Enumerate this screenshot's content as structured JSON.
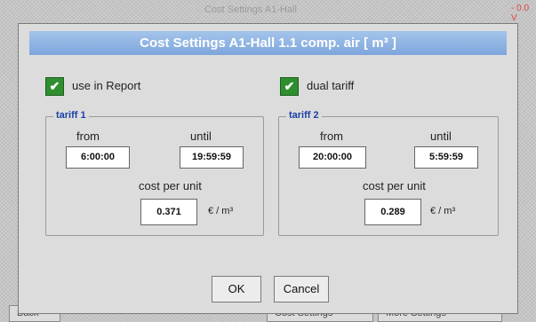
{
  "background": {
    "title": "Cost Settings A1-Hall",
    "value": "- 0.0 V",
    "tabs": [
      "Back",
      "Cost Settings",
      "More Settings"
    ]
  },
  "dialog": {
    "title": "Cost Settings A1-Hall 1.1 comp. air [ m³ ]",
    "use_in_report": {
      "label": "use in Report",
      "checked": true,
      "glyph": "✔"
    },
    "dual_tariff": {
      "label": "dual tariff",
      "checked": true,
      "glyph": "✔"
    },
    "tariff1": {
      "legend": "tariff 1",
      "from_label": "from",
      "from_value": "6:00:00",
      "until_label": "until",
      "until_value": "19:59:59",
      "cost_label": "cost per unit",
      "cost_value": "0.371",
      "unit": "€ / m³"
    },
    "tariff2": {
      "legend": "tariff 2",
      "from_label": "from",
      "from_value": "20:00:00",
      "until_label": "until",
      "until_value": "5:59:59",
      "cost_label": "cost per unit",
      "cost_value": "0.289",
      "unit": "€ / m³"
    },
    "ok_label": "OK",
    "cancel_label": "Cancel"
  },
  "colors": {
    "title_bar": "#8fb4e4",
    "checkbox": "#2f8f2f",
    "legend": "#1a3fa6"
  }
}
